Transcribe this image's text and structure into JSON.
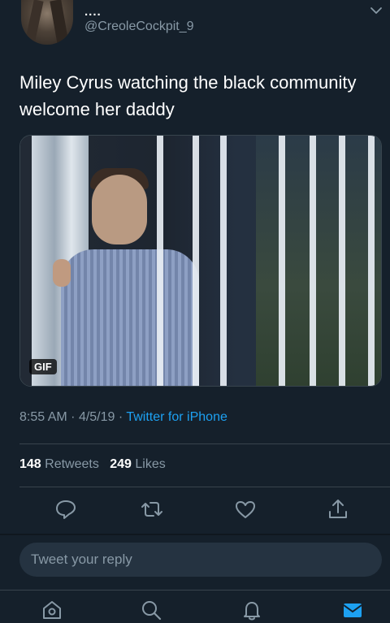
{
  "tweet": {
    "display_name": "....",
    "handle": "@CreoleCockpit_9",
    "text": "Miley Cyrus watching the black community welcome her daddy",
    "media_badge": "GIF",
    "time": "8:55 AM",
    "date": "4/5/19",
    "separator": "·",
    "source": "Twitter for iPhone",
    "retweets_count": "148",
    "retweets_label": "Retweets",
    "likes_count": "249",
    "likes_label": "Likes"
  },
  "reply": {
    "placeholder": "Tweet your reply"
  },
  "icons": {
    "header": [
      "avatar",
      "chevron-down-icon"
    ],
    "actions": [
      "reply-icon",
      "retweet-icon",
      "like-icon",
      "share-icon"
    ],
    "tabs": [
      "home-icon",
      "search-icon",
      "notifications-icon",
      "messages-icon"
    ]
  },
  "colors": {
    "background": "#15202b",
    "secondary_text": "#8899a6",
    "accent": "#1da1f2",
    "divider": "#38444d",
    "input_bg": "#253341"
  }
}
